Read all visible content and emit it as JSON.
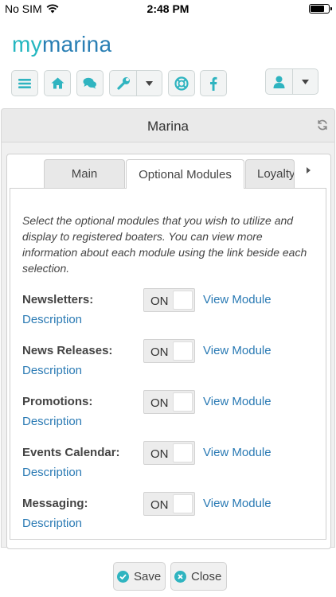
{
  "status": {
    "carrier": "No SIM",
    "time": "2:48 PM"
  },
  "logo": {
    "part1": "my",
    "part2": "marina"
  },
  "toolbar": {
    "icons": [
      "menu-icon",
      "home-icon",
      "chat-icon",
      "wrench-icon",
      "life-ring-icon",
      "facebook-icon",
      "user-icon"
    ],
    "accent": "#2fb4c0"
  },
  "header": {
    "title": "Marina"
  },
  "tabs": [
    {
      "label": "Main"
    },
    {
      "label": "Optional Modules"
    },
    {
      "label": "Loyalty"
    }
  ],
  "intro": "Select the optional modules that you wish to utilize and display to registered boaters. You can view more information about each module using the link beside each selection.",
  "modules": [
    {
      "label": "Newsletters:",
      "toggle": "ON",
      "link": "View Module",
      "desc": "Description"
    },
    {
      "label": "News Releases:",
      "toggle": "ON",
      "link": "View Module",
      "desc": "Description"
    },
    {
      "label": "Promotions:",
      "toggle": "ON",
      "link": "View Module",
      "desc": "Description"
    },
    {
      "label": "Events Calendar:",
      "toggle": "ON",
      "link": "View Module",
      "desc": "Description"
    },
    {
      "label": "Messaging:",
      "toggle": "ON",
      "link": "View Module",
      "desc": "Description"
    }
  ],
  "footer": {
    "save": "Save",
    "close": "Close"
  }
}
